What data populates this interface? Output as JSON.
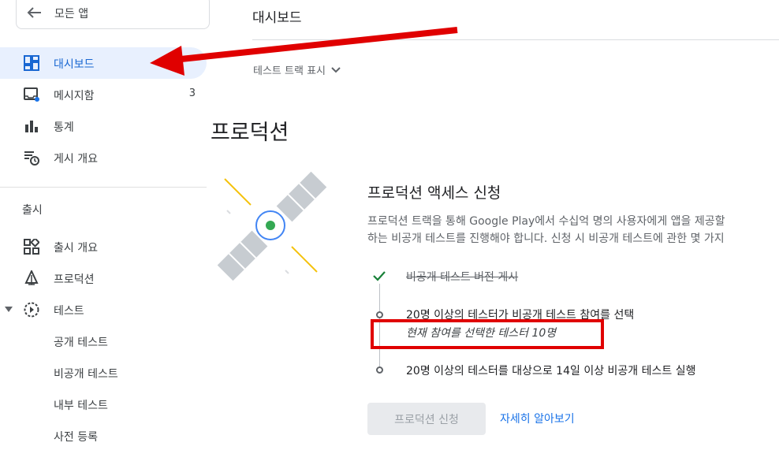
{
  "sidebar": {
    "all_apps_label": "모든 앱",
    "items": [
      {
        "label": "대시보드",
        "icon": "dashboard-icon"
      },
      {
        "label": "메시지함",
        "icon": "inbox-icon",
        "count": "3"
      },
      {
        "label": "통계",
        "icon": "bar-chart-icon"
      },
      {
        "label": "게시 개요",
        "icon": "publishing-overview-icon"
      }
    ],
    "release_section_label": "출시",
    "release_items": [
      {
        "label": "출시 개요",
        "icon": "release-overview-icon"
      },
      {
        "label": "프로덕션",
        "icon": "production-icon"
      },
      {
        "label": "테스트",
        "icon": "testing-icon"
      }
    ],
    "test_subitems": [
      "공개 테스트",
      "비공개 테스트",
      "내부 테스트",
      "사전 등록"
    ]
  },
  "header": {
    "title": "대시보드",
    "track_toggle_label": "테스트 트랙 표시"
  },
  "main": {
    "page_title": "프로덕션",
    "card": {
      "title": "프로덕션 액세스 신청",
      "description_line1": "프로덕션 트랙을 통해 Google Play에서 수십억 명의 사용자에게 앱을 제공할",
      "description_line2": "하는 비공개 테스트를 진행해야 합니다. 신청 시 비공개 테스트에 관한 몇 가지",
      "steps": [
        {
          "text": "비공개 테스트 버전 게시",
          "done": true
        },
        {
          "text": "20명 이상의 테스터가 비공개 테스트 참여를 선택",
          "done": false,
          "sub": "현재 참여를 선택한 테스터 10명"
        },
        {
          "text": "20명 이상의 테스터를 대상으로 14일 이상 비공개 테스트 실행",
          "done": false
        }
      ],
      "apply_button_label": "프로덕션 신청",
      "learn_more_label": "자세히 알아보기"
    }
  },
  "colors": {
    "accent": "#1a73e8",
    "active_bg": "#e8f0fe",
    "annotation_red": "#e00000",
    "check_green": "#188038",
    "satellite_green": "#34a853"
  }
}
